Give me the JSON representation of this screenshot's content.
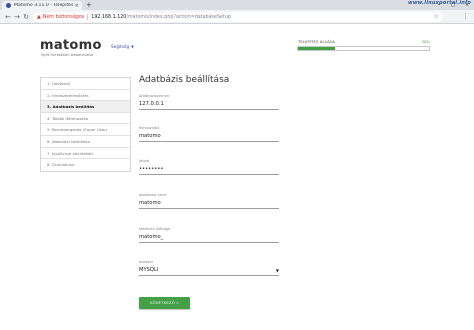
{
  "browser": {
    "tab_title": "Matomo 3.11.0 - Telepítés",
    "tab_close": "×",
    "new_tab": "+",
    "window_controls": [
      "–",
      "□",
      "×"
    ],
    "nav": {
      "back": "←",
      "forward": "→",
      "reload": "↻"
    },
    "security_warning": "Nem biztonságos",
    "url_host": "192.168.1.120",
    "url_path": "/matomo/index.php?action=databaseSetup",
    "bookmark_icon": "☆",
    "menu_icon": "⋮"
  },
  "watermark": "www.linuxportal.info",
  "header": {
    "logo": "matomo",
    "tagline": "Nyílt forráskódú webanalitika",
    "help_label": "Segítség",
    "help_caret": "▼"
  },
  "progress": {
    "label": "TELEPÍTÉS ÁLLÁSA",
    "percent_text": "28%",
    "fraction": 0.28,
    "color": "#43a047"
  },
  "steps": [
    {
      "label": "1. Üdvözlet!",
      "active": false
    },
    {
      "label": "2. rendszerellenőrzés",
      "active": false
    },
    {
      "label": "3. Adatbázis beállítás",
      "active": true
    },
    {
      "label": "4. Táblák létrehozása",
      "active": false
    },
    {
      "label": "5. Rendszergazda (Super User)",
      "active": false
    },
    {
      "label": "6. Weboldal beállítása",
      "active": false
    },
    {
      "label": "7. JavaScript követőkód",
      "active": false
    },
    {
      "label": "8. Gratulálunk",
      "active": false
    }
  ],
  "form": {
    "title": "Adatbázis beállítása",
    "fields": [
      {
        "label": "Adatbázisszerver",
        "value": "127.0.0.1"
      },
      {
        "label": "felhasználó",
        "value": "matomo"
      },
      {
        "label": "Jelszó",
        "value": "••••••••"
      },
      {
        "label": "adatbázis neve",
        "value": "matomo"
      },
      {
        "label": "táblanév előtagja",
        "value": "matomo_"
      },
      {
        "label": "adapter",
        "value": "MYSQLI",
        "arrow": "▼"
      }
    ],
    "next_button": "KÖVETKEZŐ »"
  },
  "colors": {
    "accent_green": "#43a047",
    "link_blue": "#3450a3",
    "warning_red": "#d93025"
  }
}
